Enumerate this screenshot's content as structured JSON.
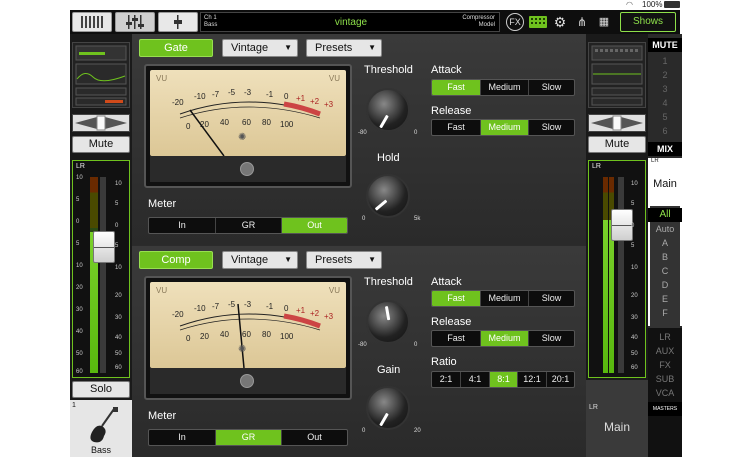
{
  "status": {
    "battery": "100%"
  },
  "channel": {
    "number": "Ch 1",
    "name_small": "Bass",
    "preset_name": "vintage",
    "model_label_1": "Compressor",
    "model_label_2": "Model"
  },
  "toolbar": {
    "shows_label": "Shows",
    "fx_label": "FX"
  },
  "left_strip": {
    "mute_label": "Mute",
    "solo_label": "Solo",
    "channel_num": "1",
    "channel_name": "Bass",
    "lr_label": "LR",
    "scale": [
      "10",
      "5",
      "0",
      "5",
      "10",
      "20",
      "30",
      "40",
      "50",
      "60"
    ]
  },
  "gate": {
    "toggle_label": "Gate",
    "model_value": "Vintage",
    "presets_label": "Presets",
    "vu_label_left": "VU",
    "vu_label_right": "VU",
    "vu_scale": [
      "-20",
      "-10",
      "-7",
      "-5",
      "-3",
      "-1",
      "0",
      "+1",
      "+2",
      "+3"
    ],
    "vu_scale2": [
      "0",
      "20",
      "40",
      "60",
      "80",
      "100"
    ],
    "meter_label": "Meter",
    "meter_options": [
      "In",
      "GR",
      "Out"
    ],
    "meter_selected": "Out",
    "threshold_label": "Threshold",
    "threshold_min": "-80",
    "threshold_max": "0",
    "hold_label": "Hold",
    "hold_min": "0",
    "hold_max": "5k",
    "attack_label": "Attack",
    "attack_options": [
      "Fast",
      "Medium",
      "Slow"
    ],
    "attack_selected": "Fast",
    "release_label": "Release",
    "release_options": [
      "Fast",
      "Medium",
      "Slow"
    ],
    "release_selected": "Medium"
  },
  "comp": {
    "toggle_label": "Comp",
    "model_value": "Vintage",
    "presets_label": "Presets",
    "vu_label_left": "VU",
    "vu_label_right": "VU",
    "vu_scale": [
      "-20",
      "-10",
      "-7",
      "-5",
      "-3",
      "-1",
      "0",
      "+1",
      "+2",
      "+3"
    ],
    "vu_scale2": [
      "0",
      "20",
      "40",
      "60",
      "80",
      "100"
    ],
    "meter_label": "Meter",
    "meter_options": [
      "In",
      "GR",
      "Out"
    ],
    "meter_selected": "GR",
    "threshold_label": "Threshold",
    "threshold_min": "-80",
    "threshold_max": "0",
    "gain_label": "Gain",
    "gain_min": "0",
    "gain_max": "20",
    "attack_label": "Attack",
    "attack_options": [
      "Fast",
      "Medium",
      "Slow"
    ],
    "attack_selected": "Fast",
    "release_label": "Release",
    "release_options": [
      "Fast",
      "Medium",
      "Slow"
    ],
    "release_selected": "Medium",
    "ratio_label": "Ratio",
    "ratio_options": [
      "2:1",
      "4:1",
      "8:1",
      "12:1",
      "20:1"
    ],
    "ratio_selected": "8:1"
  },
  "right_strip": {
    "mute_label": "Mute",
    "lr_label": "LR",
    "main_label": "Main",
    "bottom_lr": "LR",
    "bottom_main": "Main"
  },
  "mute_column": {
    "header": "MUTE",
    "groups": [
      "1",
      "2",
      "3",
      "4",
      "5",
      "6"
    ],
    "mix_header": "MIX"
  },
  "filter_column": {
    "items": [
      "All",
      "Auto",
      "A",
      "B",
      "C",
      "D",
      "E",
      "F"
    ],
    "selected": "All",
    "buses": [
      "LR",
      "AUX",
      "FX",
      "SUB",
      "VCA"
    ],
    "masters": "MASTERS"
  },
  "colors": {
    "accent": "#6fc21e",
    "preset_text": "#8ee04a"
  }
}
